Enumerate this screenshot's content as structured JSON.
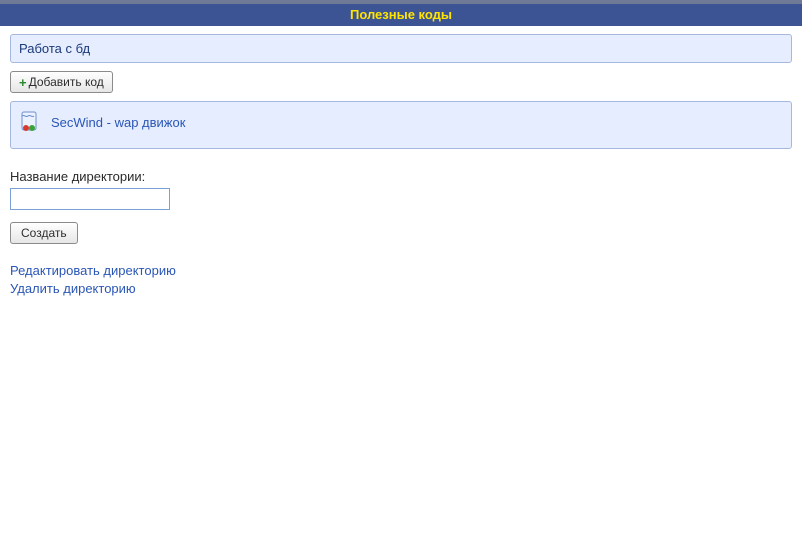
{
  "header": {
    "title": "Полезные коды"
  },
  "breadcrumb": {
    "text": "Работа с бд"
  },
  "toolbar": {
    "add_button_label": "Добавить код"
  },
  "entry": {
    "link_text": "SecWind - wap движок"
  },
  "form": {
    "dir_label": "Название директории:",
    "dir_value": "",
    "create_button_label": "Создать"
  },
  "links": {
    "edit": "Редактировать директорию",
    "delete": "Удалить директорию"
  }
}
